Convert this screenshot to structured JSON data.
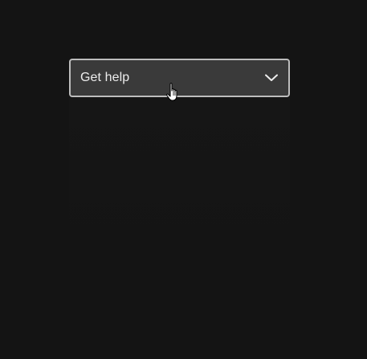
{
  "help_menu": {
    "selected_label": "Get help",
    "chevron_icon": "chevron-down-icon"
  },
  "cursor_icon": "hand-pointer-icon",
  "colors": {
    "background": "#141414",
    "dropdown_bg": "#3a3a3a",
    "dropdown_border": "#bdbdbd",
    "text": "#ededed"
  }
}
